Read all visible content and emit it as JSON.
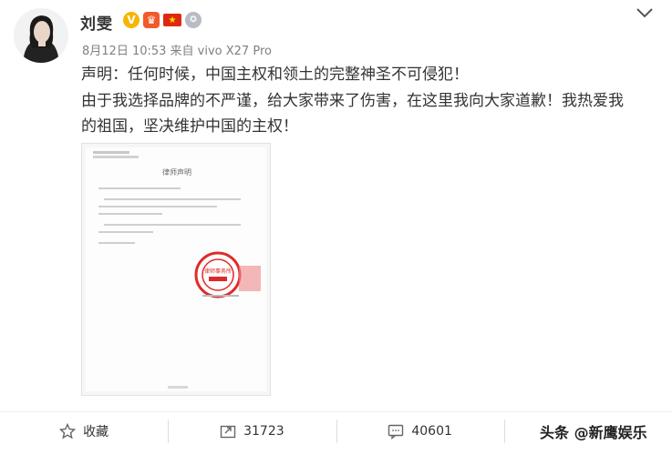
{
  "post": {
    "author": "刘雯",
    "meta": "8月12日 10:53 来自 vivo X27 Pro",
    "paragraph_1": "声明：任何时候，中国主权和领土的完整神圣不可侵犯！",
    "paragraph_2_line_1": "由于我选择品牌的不严谨，给大家带来了伤害，在这里我向大家道歉！我热爱我",
    "paragraph_2_line_2": "的祖国，坚决维护中国的主权！"
  },
  "document": {
    "title": "律师声明",
    "seal_text": "律师事务所"
  },
  "actions": {
    "favorite_label": "收藏",
    "repost_count": "31723",
    "comment_count": "40601"
  },
  "watermark": "头条 @新鹰娱乐",
  "colors": {
    "verified_badge": "#f7b500",
    "seal_red": "#e02a2a"
  }
}
